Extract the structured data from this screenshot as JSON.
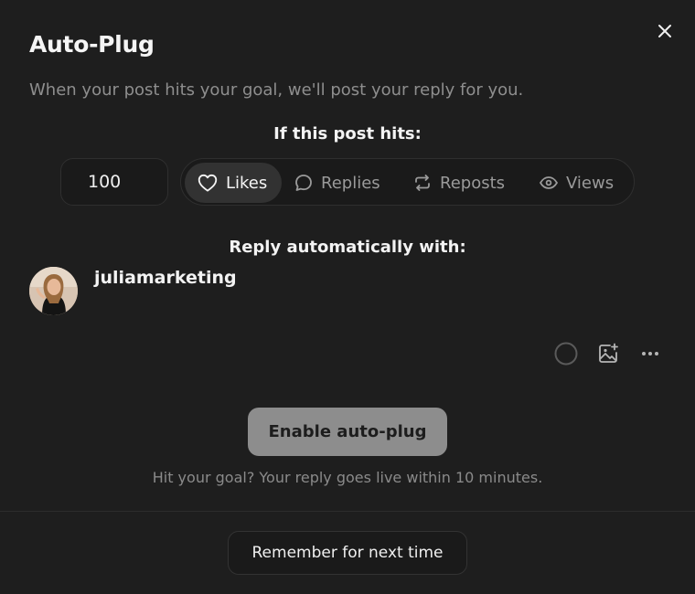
{
  "dialog": {
    "title": "Auto-Plug",
    "subtitle": "When your post hits your goal, we'll post your reply for you."
  },
  "goal": {
    "label": "If this post hits:",
    "value": "100",
    "metrics": [
      {
        "label": "Likes",
        "icon": "heart-icon",
        "selected": true
      },
      {
        "label": "Replies",
        "icon": "speech-bubble-icon",
        "selected": false
      },
      {
        "label": "Reposts",
        "icon": "repost-icon",
        "selected": false
      },
      {
        "label": "Views",
        "icon": "eye-icon",
        "selected": false
      }
    ]
  },
  "reply": {
    "label": "Reply automatically with:",
    "username": "juliamarketing",
    "tools": [
      "circle-progress-icon",
      "add-image-icon",
      "more-options-icon"
    ]
  },
  "actions": {
    "enable_label": "Enable auto-plug",
    "hint": "Hit your goal? Your reply goes live within 10 minutes.",
    "remember_label": "Remember for next time"
  },
  "colors": {
    "background": "#1e1e1e",
    "text_primary": "#f3f3f3",
    "text_muted": "#8e8e8e",
    "disabled_button": "#8d8d8d",
    "active_pill": "#323232"
  }
}
